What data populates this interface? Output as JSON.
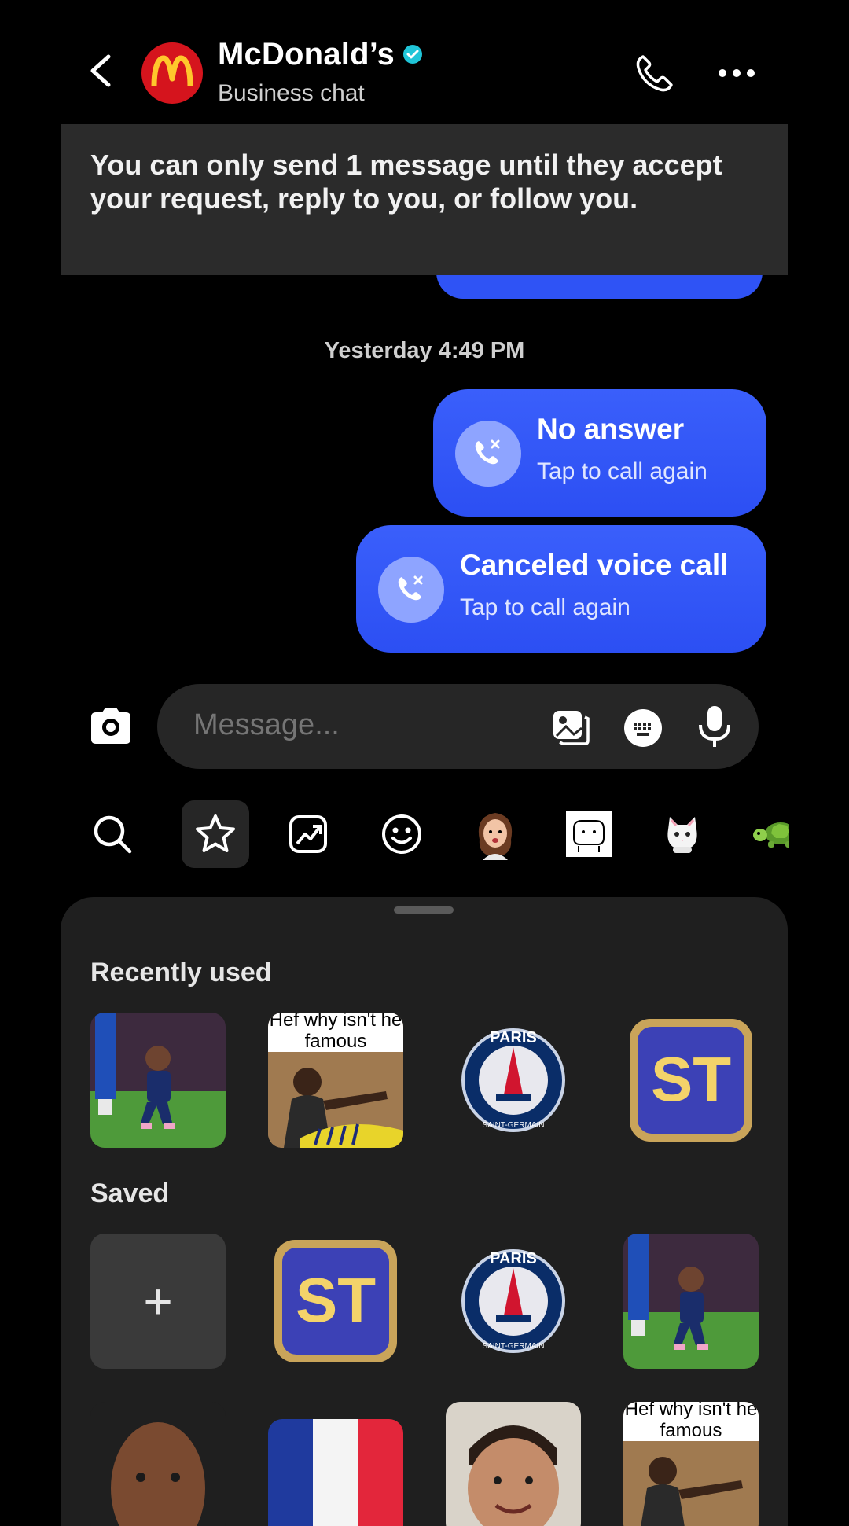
{
  "header": {
    "title": "McDonald’s",
    "subtitle": "Business chat",
    "brand_color": "#d5141d",
    "logo_accent": "#ffc72c",
    "verified_color": "#20c5d8"
  },
  "banner": {
    "text": "You can only send 1 message until they accept your request, reply to you, or follow you."
  },
  "timestamp": "Yesterday 4:49 PM",
  "messages": [
    {
      "title": "No answer",
      "subtitle": "Tap to call again",
      "icon": "missed-call-icon"
    },
    {
      "title": "Canceled voice call",
      "subtitle": "Tap to call again",
      "icon": "missed-call-icon"
    }
  ],
  "composer": {
    "placeholder": "Message..."
  },
  "sticker_tabs": [
    {
      "icon": "search-icon"
    },
    {
      "icon": "star-icon",
      "active": true
    },
    {
      "icon": "trending-icon"
    },
    {
      "icon": "emoji-icon"
    },
    {
      "icon": "avatar-sticker-icon"
    },
    {
      "icon": "sticker-pack-icon"
    },
    {
      "icon": "cat-sticker-icon"
    },
    {
      "icon": "turtle-sticker-icon"
    }
  ],
  "sheet": {
    "recently_used_title": "Recently used",
    "saved_title": "Saved",
    "meme_caption": "Hef why isn't he famous",
    "st_badge": "ST",
    "psg_top": "PARIS",
    "psg_bottom": "SAINT-GERMAIN",
    "add_label": "+"
  },
  "colors": {
    "bubble": "#2f53f5",
    "sheet_bg": "#1f1f1f",
    "banner_bg": "#2b2b2b"
  }
}
